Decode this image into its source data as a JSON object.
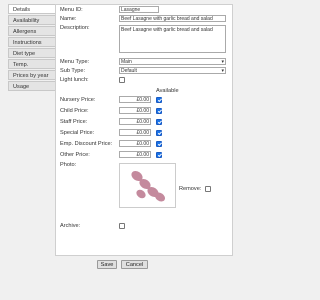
{
  "tabs": [
    "Details",
    "Availability",
    "Allergens",
    "Instructions",
    "Diet type",
    "Temp.",
    "Prices by year",
    "Usage"
  ],
  "form": {
    "menu_id": {
      "label": "Menu ID:",
      "value": "Lasagne"
    },
    "name": {
      "label": "Name:",
      "value": "Beef Lasagne with garlic bread and salad"
    },
    "description": {
      "label": "Description:",
      "value": "Beef Lasagne with garlic bread and salad"
    },
    "menu_type": {
      "label": "Menu Type:",
      "value": "Main"
    },
    "sub_type": {
      "label": "Sub Type:",
      "value": "Default"
    },
    "light_lunch": {
      "label": "Light lunch:",
      "checked": false
    },
    "available_header": "Available",
    "prices": [
      {
        "label": "Nursery Price:",
        "value": "£0.00",
        "available": true
      },
      {
        "label": "Child Price:",
        "value": "£0.00",
        "available": true
      },
      {
        "label": "Staff Price:",
        "value": "£0.00",
        "available": true
      },
      {
        "label": "Special Price:",
        "value": "£0.00",
        "available": true
      },
      {
        "label": "Emp. Discount Price:",
        "value": "£0.00",
        "available": true
      },
      {
        "label": "Other Price:",
        "value": "£0.00",
        "available": true
      }
    ],
    "photo": {
      "label": "Photo:",
      "remove_label": "Remove:",
      "remove_checked": false
    },
    "archive": {
      "label": "Archive:",
      "checked": false
    }
  },
  "buttons": {
    "save": "Save",
    "cancel": "Cancel"
  },
  "colors": {
    "checkbox_checked": "#1a73e8",
    "logo": "#c48a9d"
  }
}
